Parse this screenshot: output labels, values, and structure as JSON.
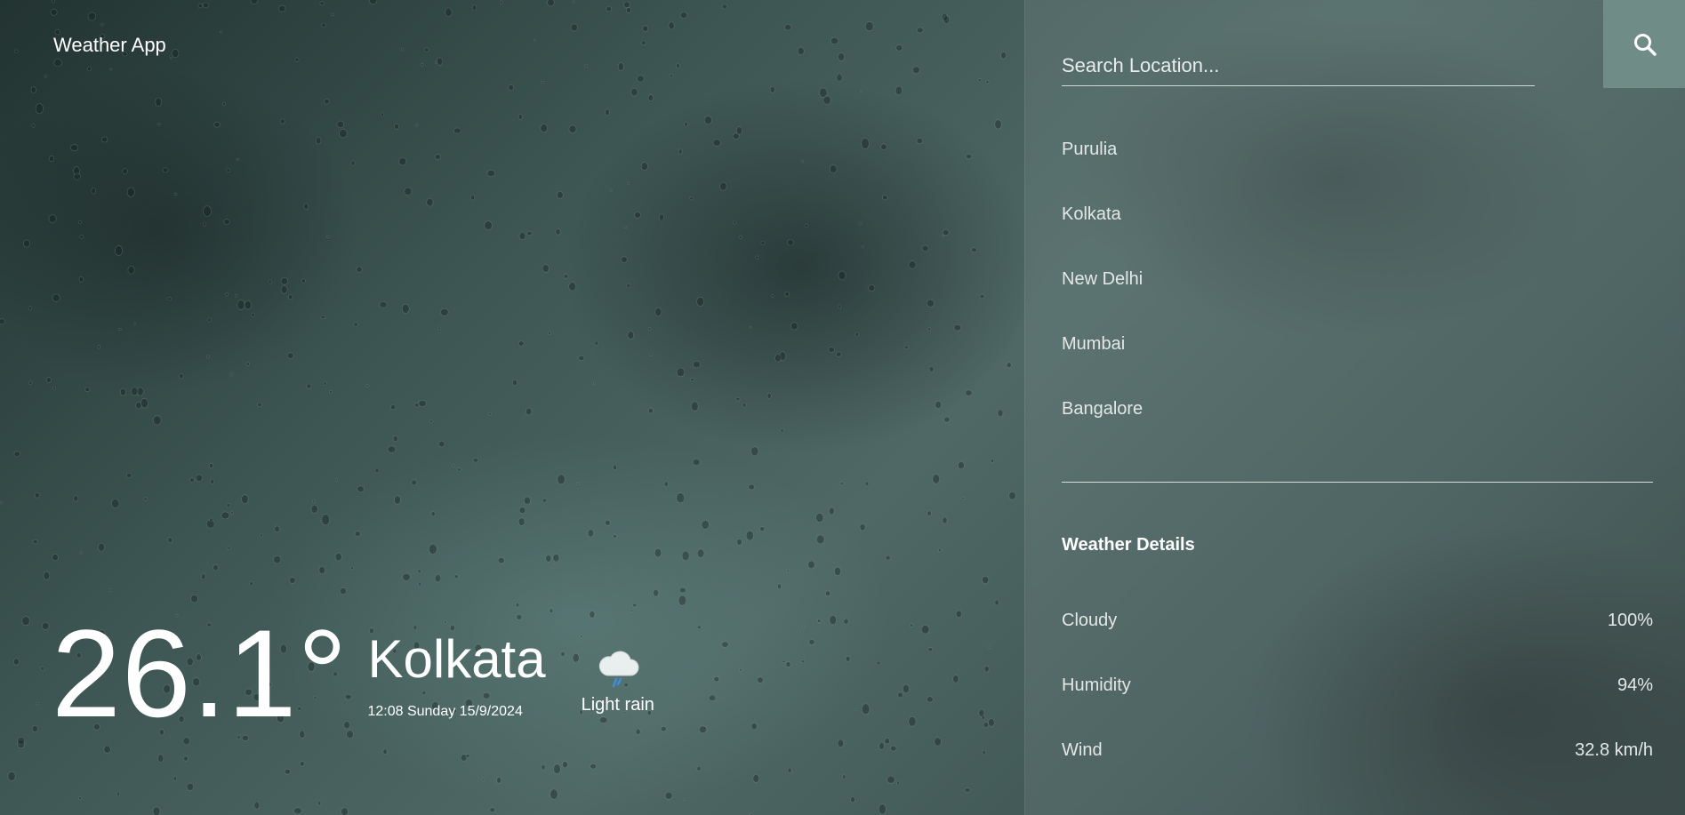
{
  "app": {
    "title": "Weather App"
  },
  "current": {
    "temperature": "26.1°",
    "city": "Kolkata",
    "datetime": "12:08 Sunday 15/9/2024",
    "condition": "Light rain",
    "condition_icon": "cloud-rain-icon"
  },
  "search": {
    "placeholder": "Search Location...",
    "value": "",
    "button_icon": "search-icon"
  },
  "locations": [
    "Purulia",
    "Kolkata",
    "New Delhi",
    "Mumbai",
    "Bangalore"
  ],
  "details": {
    "title": "Weather Details",
    "rows": [
      {
        "label": "Cloudy",
        "value": "100%"
      },
      {
        "label": "Humidity",
        "value": "94%"
      },
      {
        "label": "Wind",
        "value": "32.8 km/h"
      }
    ]
  },
  "colors": {
    "search_button": "#6f8d86",
    "text": "#ffffff"
  }
}
